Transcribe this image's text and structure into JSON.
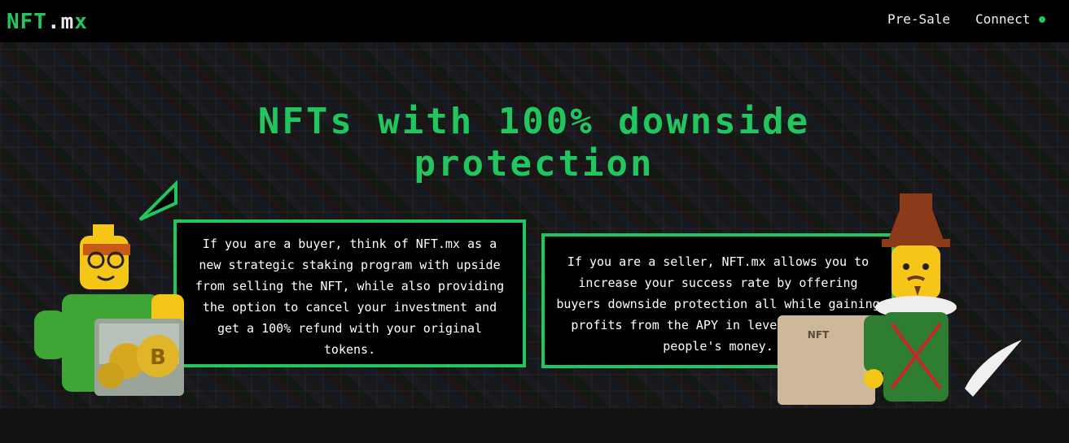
{
  "brand": {
    "part1": "NFT",
    "part2": ".m",
    "part3": "x"
  },
  "nav": {
    "presale": "Pre-Sale",
    "connect": "Connect"
  },
  "colors": {
    "accent": "#22c55e",
    "background": "#000000"
  },
  "hero": {
    "headline": "NFTs with 100% downside protection",
    "buyer_text": "If you are a buyer, think of NFT.mx as a new strategic staking program with upside from selling the NFT, while also providing the option to cancel your investment and get a 100% refund with your original tokens.",
    "seller_text": "If you are a seller, NFT.mx allows you to increase your success rate by offering buyers downside protection all while gaining profits from the APY in leveraging other people's money."
  },
  "icons": {
    "connect_status": "status-dot-icon",
    "buyer_figure": "lego-buyer-figure",
    "seller_figure": "lego-seller-figure"
  }
}
